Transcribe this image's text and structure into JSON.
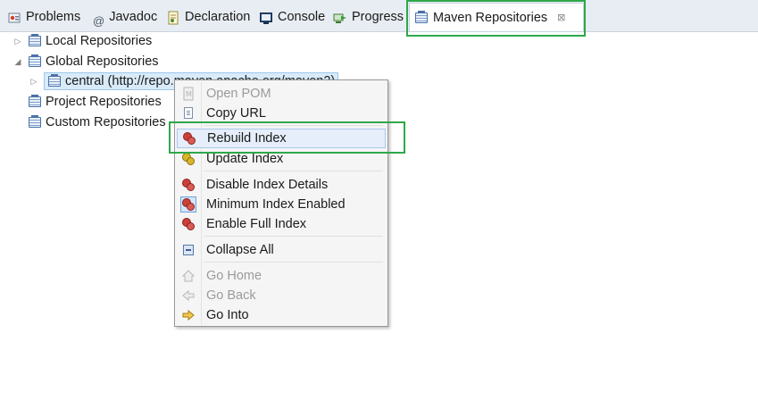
{
  "tabs": [
    {
      "label": "Problems",
      "icon": "problems-icon"
    },
    {
      "label": "Javadoc",
      "icon": "javadoc-icon",
      "glyph": "@"
    },
    {
      "label": "Declaration",
      "icon": "declaration-icon"
    },
    {
      "label": "Console",
      "icon": "console-icon"
    },
    {
      "label": "Progress",
      "icon": "progress-icon"
    },
    {
      "label": "Maven Repositories",
      "icon": "maven-repositories-icon",
      "close_glyph": "⊠"
    }
  ],
  "tree": {
    "expand_glyph": "▷",
    "collapse_glyph": "◢",
    "nodes": [
      {
        "label": "Local Repositories"
      },
      {
        "label": "Global Repositories"
      },
      {
        "label": "central (http://repo.maven.apache.org/maven2)"
      },
      {
        "label": "Project Repositories"
      },
      {
        "label": "Custom Repositories"
      }
    ]
  },
  "context_menu": {
    "items": [
      {
        "label": "Open POM",
        "icon": "pom-file-icon"
      },
      {
        "label": "Copy URL",
        "icon": "copy-icon"
      },
      {
        "label": "Rebuild Index",
        "icon": "rebuild-index-icon"
      },
      {
        "label": "Update Index",
        "icon": "update-index-icon"
      },
      {
        "label": "Disable Index Details",
        "icon": "index-gear-icon"
      },
      {
        "label": "Minimum Index Enabled",
        "icon": "index-gear-icon"
      },
      {
        "label": "Enable Full Index",
        "icon": "index-gear-icon"
      },
      {
        "label": "Collapse All",
        "icon": "collapse-all-icon"
      },
      {
        "label": "Go Home",
        "icon": "home-icon"
      },
      {
        "label": "Go Back",
        "icon": "back-arrow-icon"
      },
      {
        "label": "Go Into",
        "icon": "go-into-arrow-icon"
      }
    ]
  },
  "colors": {
    "highlight": "#2ea84a",
    "selection": "#d9ebf9",
    "menu_hover": "#e5eefa"
  }
}
